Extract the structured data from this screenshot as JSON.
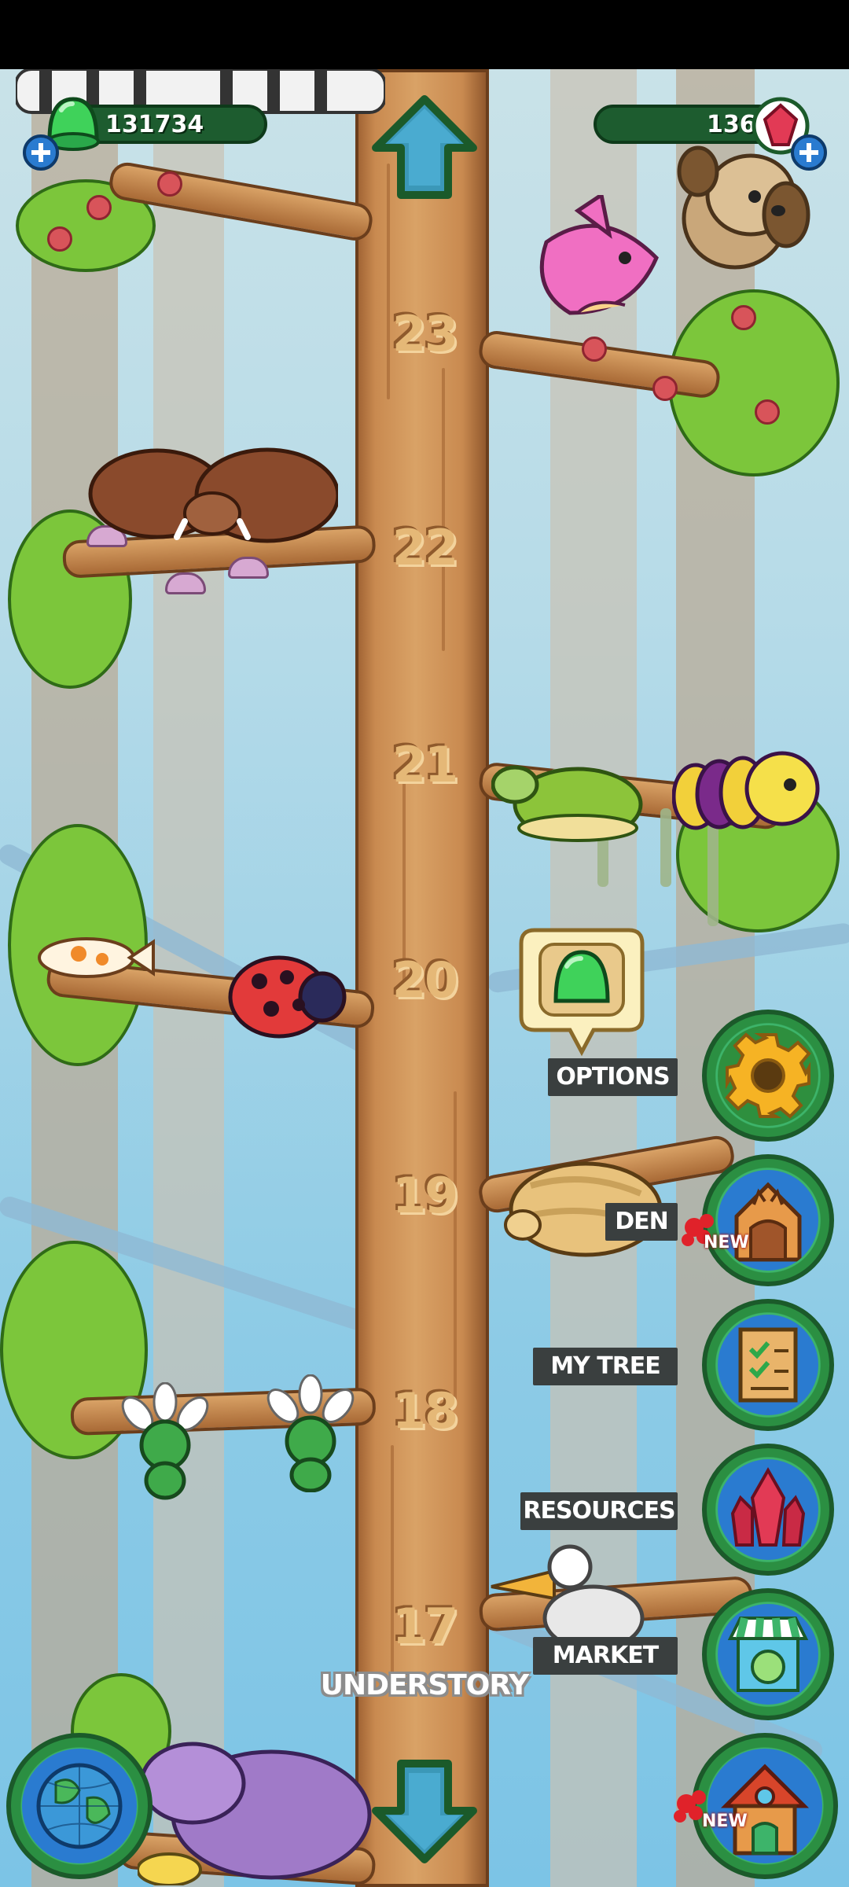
{
  "top_bar": {
    "jelly_count": "131734",
    "gem_count": "136"
  },
  "tree_levels": [
    "23",
    "22",
    "21",
    "20",
    "19",
    "18",
    "17"
  ],
  "side_menu": {
    "options_label": "OPTIONS",
    "den_label": "DEN",
    "my_tree_label": "MY TREE",
    "resources_label": "RESOURCES",
    "market_label": "MARKET",
    "new_badge": "NEW"
  },
  "region_name": "UNDERSTORY",
  "colors": {
    "trunk": "#d9a266",
    "menu_ring": "#2b8f42",
    "label_bg": "#3a3f3f",
    "jelly_green": "#3fd25a",
    "gem_red": "#e23a55"
  },
  "icons": {
    "up_arrow": "up-arrow-icon",
    "down_arrow": "down-arrow-icon",
    "options": "gear-icon",
    "den": "den-house-cat-icon",
    "my_tree": "scroll-checklist-icon",
    "resources": "crystal-icon",
    "market": "market-stall-cat-icon",
    "home": "treehouse-icon",
    "map": "globe-icon"
  }
}
